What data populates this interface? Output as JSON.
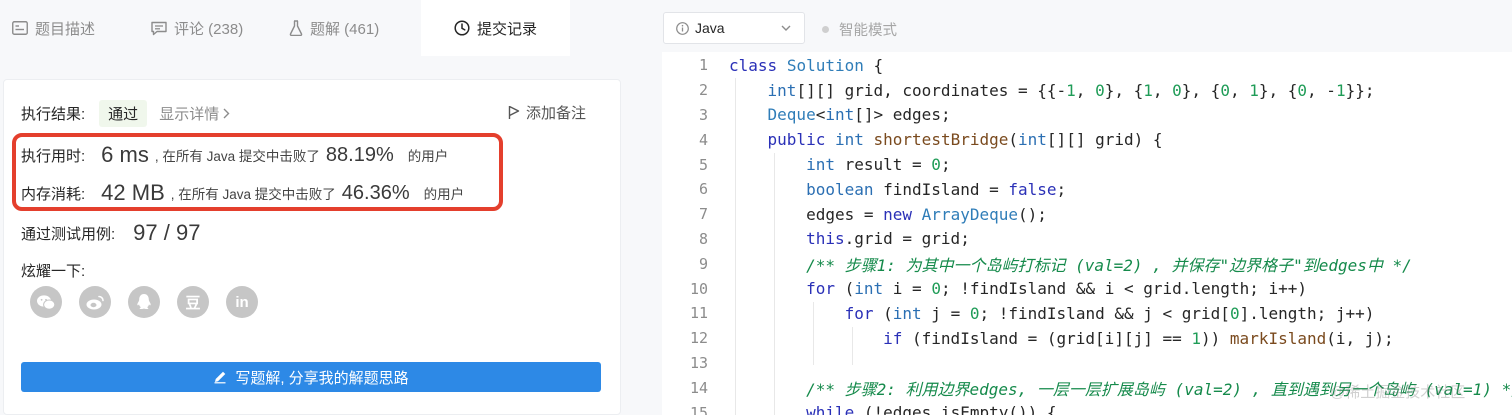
{
  "tabs": [
    {
      "label": "题目描述",
      "icon": "description-icon"
    },
    {
      "label": "评论 (238)",
      "icon": "comment-icon"
    },
    {
      "label": "题解 (461)",
      "icon": "flask-icon"
    },
    {
      "label": "提交记录",
      "icon": "clock-icon",
      "active": true
    }
  ],
  "result": {
    "label": "执行结果:",
    "status": "通过",
    "detail_link": "显示详情",
    "add_note": "添加备注"
  },
  "runtime": {
    "label": "执行用时:",
    "value": "6 ms",
    "middle": ", 在所有 Java 提交中击败了",
    "percent": "88.19%",
    "suffix": "的用户"
  },
  "memory": {
    "label": "内存消耗:",
    "value": "42 MB",
    "middle": ", 在所有 Java 提交中击败了",
    "percent": "46.36%",
    "suffix": "的用户"
  },
  "tests": {
    "label": "通过测试用例:",
    "value": "97 / 97"
  },
  "share": {
    "label": "炫耀一下:",
    "icons": [
      "wechat-icon",
      "weibo-icon",
      "qq-icon",
      "douban-icon",
      "linkedin-icon"
    ],
    "douban_glyph": "豆",
    "linkedin_glyph": "in"
  },
  "write_button": "写题解, 分享我的解题思路",
  "editor": {
    "language": "Java",
    "smart_mode": "智能模式",
    "line_numbers": [
      "1",
      "2",
      "3",
      "4",
      "5",
      "6",
      "7",
      "8",
      "9",
      "10",
      "11",
      "12",
      "13",
      "14",
      "15"
    ]
  },
  "watermark": "@稀土掘金技术社区",
  "colors": {
    "accent_blue": "#2d89e6",
    "highlight_red": "#e43f2d",
    "pass_bg": "#f0f7ec"
  }
}
